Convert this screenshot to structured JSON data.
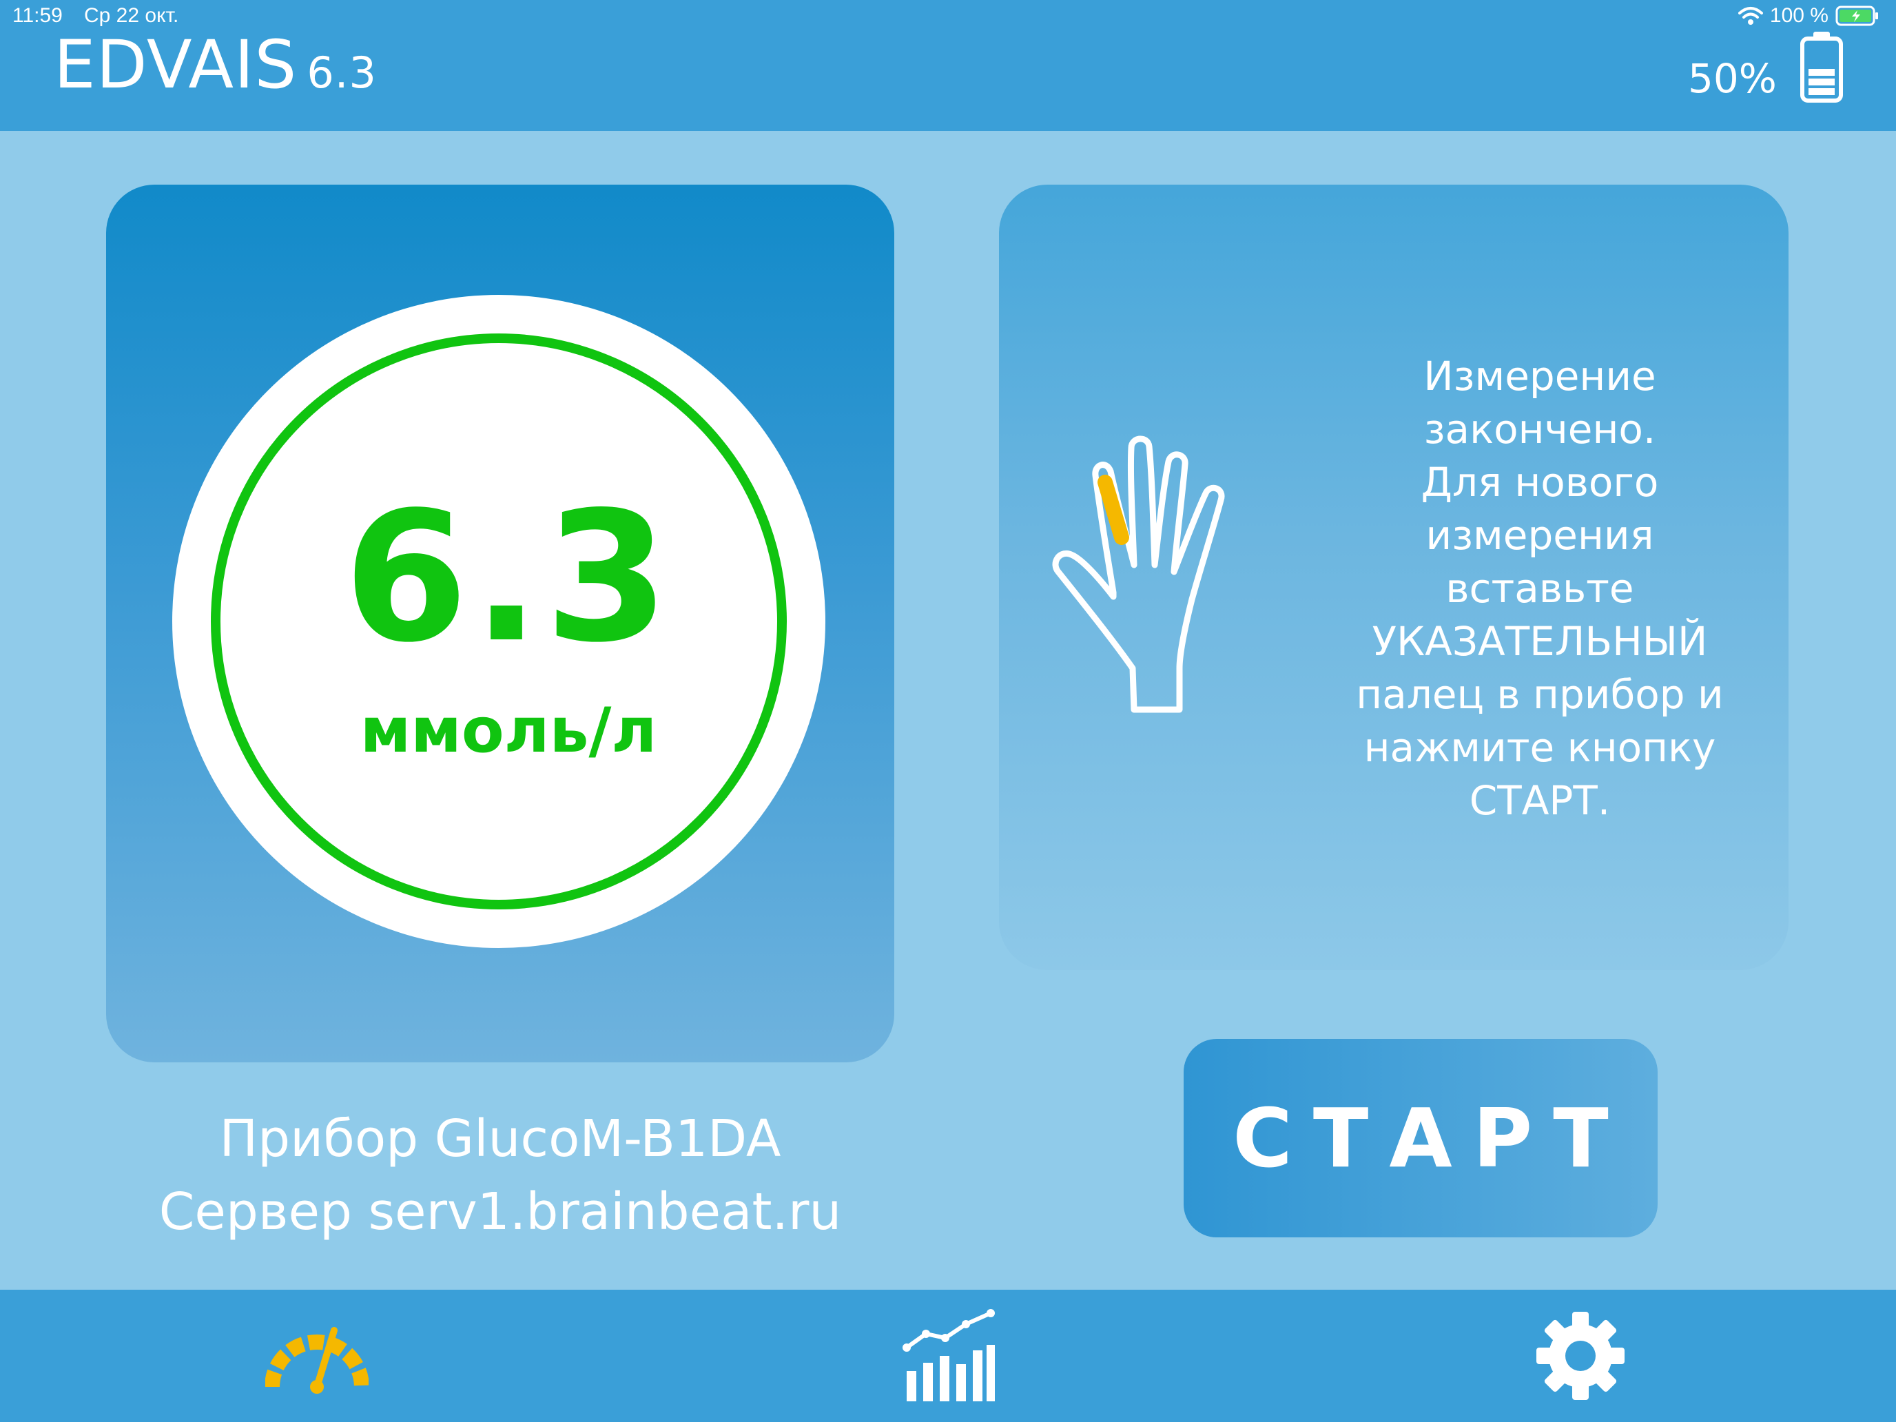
{
  "status_bar": {
    "time": "11:59",
    "date": "Ср 22 окт.",
    "battery": "100 %"
  },
  "header": {
    "app_name": "EDVAIS",
    "version": "6.3",
    "device_battery": "50%",
    "device_battery_level": 0.5
  },
  "result": {
    "value": "6.3",
    "unit": "ммоль/л",
    "ring_color": "#10c410"
  },
  "instruction": {
    "lines": [
      "Измерение",
      "закончено.",
      "Для нового",
      "измерения",
      "вставьте",
      "УКАЗАТЕЛЬНЫЙ",
      "палец в прибор и",
      "нажмите кнопку",
      "СТАРТ."
    ],
    "highlight_color": "#f5b800"
  },
  "device": {
    "device_line": "Прибор GlucoM-B1DA",
    "server_line": "Сервер serv1.brainbeat.ru"
  },
  "start_button": {
    "label": "СТАРТ"
  },
  "tabs": [
    {
      "icon": "gauge-icon",
      "active": true,
      "color": "#f5b800"
    },
    {
      "icon": "statistics-icon",
      "active": false,
      "color": "#ffffff"
    },
    {
      "icon": "gear-icon",
      "active": false,
      "color": "#ffffff"
    }
  ],
  "colors": {
    "header": "#3a9fd8",
    "background": "#90cbea",
    "accent_green": "#10c410"
  }
}
